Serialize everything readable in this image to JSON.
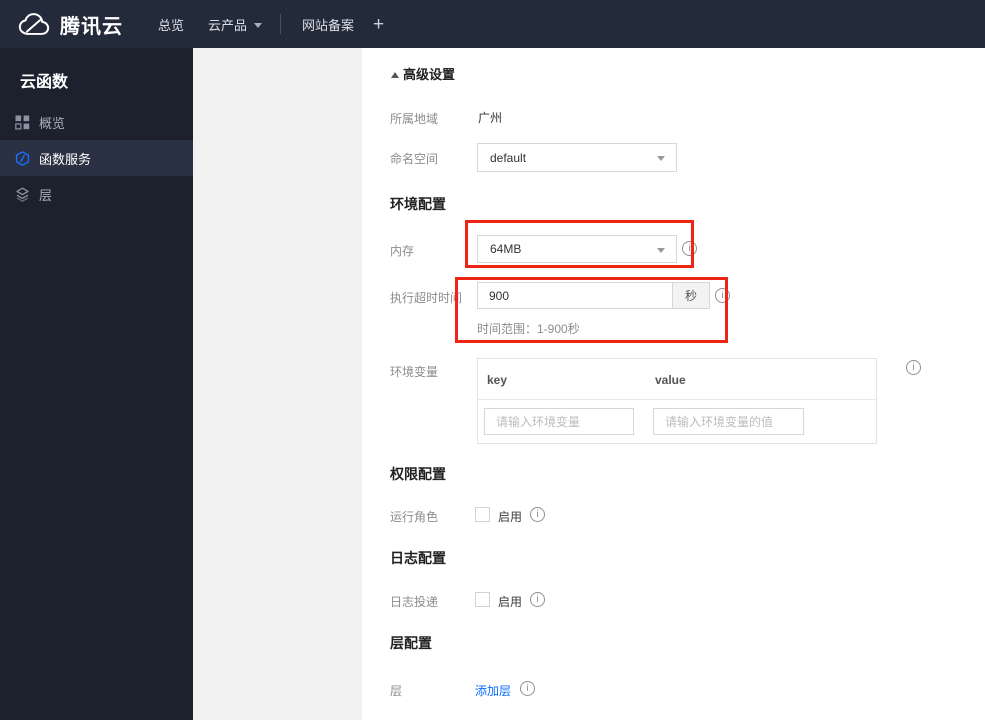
{
  "navbar": {
    "brand": "腾讯云",
    "items": [
      "总览",
      "云产品",
      "网站备案"
    ],
    "plus": "+"
  },
  "sidebar": {
    "title": "云函数",
    "items": [
      {
        "label": "概览",
        "icon": "grid-icon",
        "selected": false
      },
      {
        "label": "函数服务",
        "icon": "function-hexagon-icon",
        "selected": true
      },
      {
        "label": "层",
        "icon": "layers-icon",
        "selected": false
      }
    ]
  },
  "form": {
    "advanced": {
      "label": "高级设置"
    },
    "region": {
      "label": "所属地域",
      "value": "广州"
    },
    "namespace": {
      "label": "命名空间",
      "value": "default"
    },
    "env_config": {
      "heading": "环境配置",
      "memory": {
        "label": "内存",
        "value": "64MB"
      },
      "timeout": {
        "label": "执行超时时间",
        "value": "900",
        "unit": "秒",
        "hint": "时间范围：1-900秒"
      },
      "env_vars": {
        "label": "环境变量",
        "key_header": "key",
        "value_header": "value",
        "key_placeholder": "请输入环境变量",
        "value_placeholder": "请输入环境变量的值"
      }
    },
    "perm_config": {
      "heading": "权限配置",
      "role": {
        "label": "运行角色",
        "checkbox_label": "启用",
        "checked": false
      }
    },
    "log_config": {
      "heading": "日志配置",
      "delivery": {
        "label": "日志投递",
        "checkbox_label": "启用",
        "checked": false
      }
    },
    "layer_config": {
      "heading": "层配置",
      "layer": {
        "label": "层",
        "add_link": "添加层"
      }
    }
  },
  "colors": {
    "navbar_bg": "#232b3b",
    "sidebar_bg": "#1d212e",
    "sidebar_selected_bg": "#2a3142",
    "panel_gray": "#f1f1f2",
    "accent_red": "#ee2417",
    "link_blue": "#0a6cff",
    "brand_icon_blue": "#1a6eff"
  }
}
